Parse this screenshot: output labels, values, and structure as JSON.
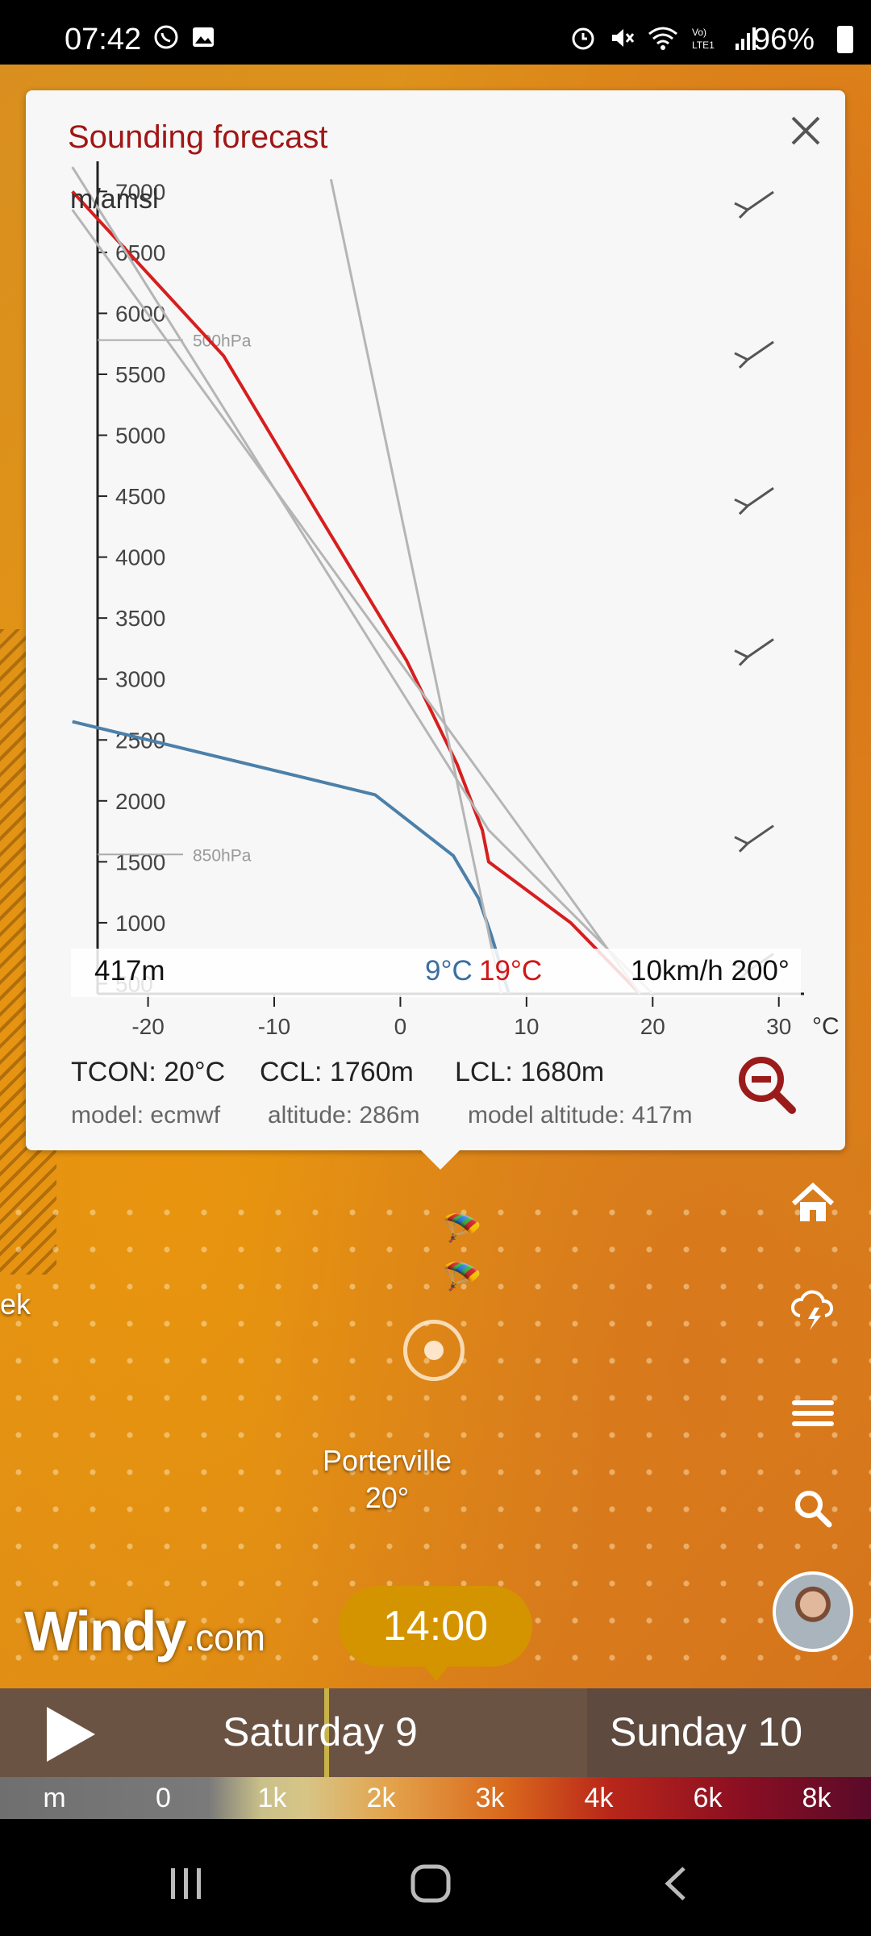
{
  "status": {
    "time": "07:42",
    "battery": "96%"
  },
  "dialog": {
    "title": "Sounding forecast",
    "close_icon": "close-icon",
    "y_unit": "m/amsl",
    "x_unit": "°C",
    "info": {
      "altitude": "417m",
      "dewpoint": "9°C",
      "temperature": "19°C",
      "wind": "10km/h 200°"
    },
    "stats": {
      "tcon": "TCON: 20°C",
      "ccl": "CCL: 1760m",
      "lcl": "LCL: 1680m",
      "model": "model: ecmwf",
      "altitude": "altitude: 286m",
      "model_altitude": "model altitude: 417m"
    }
  },
  "chart_data": {
    "type": "line",
    "ylabel": "m/amsl",
    "xlabel": "°C",
    "ylim": [
      417,
      7300
    ],
    "xlim": [
      -24,
      32
    ],
    "y_ticks": [
      500,
      1000,
      1500,
      2000,
      2500,
      3000,
      3500,
      4000,
      4500,
      5000,
      5500,
      6000,
      6500,
      7000
    ],
    "x_ticks": [
      -20,
      -10,
      0,
      10,
      20,
      30
    ],
    "pressure_levels": [
      {
        "label": "500hPa",
        "altitude": 5780
      },
      {
        "label": "850hPa",
        "altitude": 1560
      }
    ],
    "series": [
      {
        "color": "#d71e1e",
        "points": [
          [
            19,
            417
          ],
          [
            13.5,
            1000
          ],
          [
            7,
            1500
          ],
          [
            6.5,
            1760
          ],
          [
            4.5,
            2300
          ],
          [
            0.5,
            3150
          ],
          [
            -6.5,
            4350
          ],
          [
            -14,
            5650
          ],
          [
            -26,
            7000
          ]
        ]
      },
      {
        "color": "#4b80aa",
        "points": [
          [
            8.6,
            417
          ],
          [
            7.2,
            900
          ],
          [
            6.2,
            1200
          ],
          [
            4.2,
            1550
          ],
          [
            -2,
            2050
          ],
          [
            -26,
            2650
          ]
        ]
      },
      {
        "color": "#b5b5b5",
        "points": [
          [
            19,
            417
          ],
          [
            -26,
            6850
          ]
        ]
      },
      {
        "color": "#b5b5b5",
        "points": [
          [
            8,
            417
          ],
          [
            -5.5,
            7100
          ]
        ]
      },
      {
        "color": "#b5b5b5",
        "points": [
          [
            20,
            417
          ],
          [
            7,
            1760
          ],
          [
            -26,
            7200
          ]
        ]
      }
    ],
    "wind_barbs": [
      {
        "altitude": 6850
      },
      {
        "altitude": 5620
      },
      {
        "altitude": 4420
      },
      {
        "altitude": 3180
      },
      {
        "altitude": 1650
      },
      {
        "altitude": 600
      }
    ]
  },
  "map": {
    "city": "Porterville",
    "city_temp": "20°",
    "edge_text": "ek",
    "brand": "Windy",
    "brand_suffix": ".com",
    "time_pill": "14:00"
  },
  "timeline": {
    "day1": "Saturday 9",
    "day2": "Sunday 10"
  },
  "legend": [
    "m",
    "0",
    "1k",
    "2k",
    "3k",
    "4k",
    "6k",
    "8k"
  ],
  "side_buttons": [
    "home-icon",
    "thunderstorm-icon",
    "menu-icon",
    "search-icon"
  ]
}
